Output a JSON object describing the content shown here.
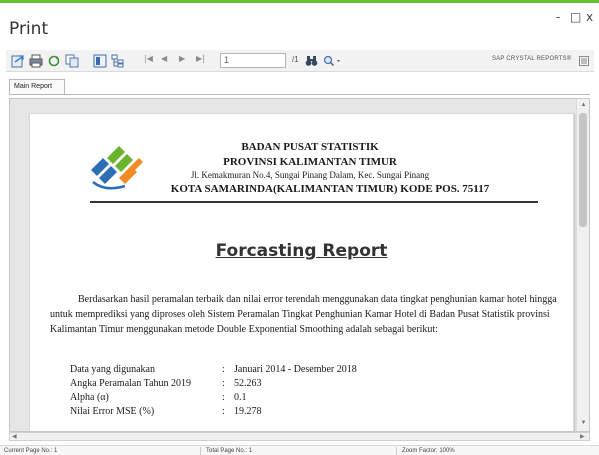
{
  "window": {
    "title": "Print",
    "minimize": "-",
    "maximize": "□",
    "close": "x",
    "accent_color": "#6abf2e"
  },
  "toolbar": {
    "buttons": [
      "export-icon",
      "print-icon",
      "refresh-icon",
      "copy-icon",
      "toggle-tree-icon",
      "group-tree-icon"
    ],
    "nav_first": "|◀",
    "nav_prev": "◀",
    "nav_next": "▶",
    "nav_last": "▶|",
    "page_value": "1",
    "page_of": "/1",
    "find_icon": "binoculars-icon",
    "zoom_icon": "zoom-icon",
    "brand": "SAP CRYSTAL REPORTS®"
  },
  "tabs": {
    "main": "Main Report"
  },
  "report": {
    "org": "BADAN PUSAT STATISTIK",
    "province": "PROVINSI KALIMANTAN TIMUR",
    "address": "Jl. Kemakmuran No.4, Sungai Pinang Dalam, Kec. Sungai Pinang",
    "city": "KOTA SAMARINDA(KALIMANTAN TIMUR) KODE POS. 75117",
    "title": "Forcasting Report",
    "paragraph": "Berdasarkan hasil peramalan terbaik dan nilai error terendah menggunakan data tingkat penghunian kamar hotel hingga  untuk memprediksi  yang diproses oleh Sistem Peramalan Tingkat Penghunian Kamar Hotel di Badan Pusat Statistik provinsi Kalimantan Timur menggunakan metode Double Exponential Smoothing adalah sebagai berikut:",
    "details": [
      {
        "label": "Data yang digunakan",
        "sep": ":",
        "value": "Januari 2014 - Desember 2018"
      },
      {
        "label": "Angka Peramalan Tahun 2019",
        "sep": ":",
        "value": "52.263"
      },
      {
        "label": "Alpha (α)",
        "sep": ":",
        "value": "0.1"
      },
      {
        "label": "Nilai Error MSE (%)",
        "sep": ":",
        "value": "19.278"
      }
    ]
  },
  "status": {
    "current_page": "Current Page No.: 1",
    "total_page": "Total Page No.: 1",
    "zoom": "Zoom Factor: 100%"
  }
}
